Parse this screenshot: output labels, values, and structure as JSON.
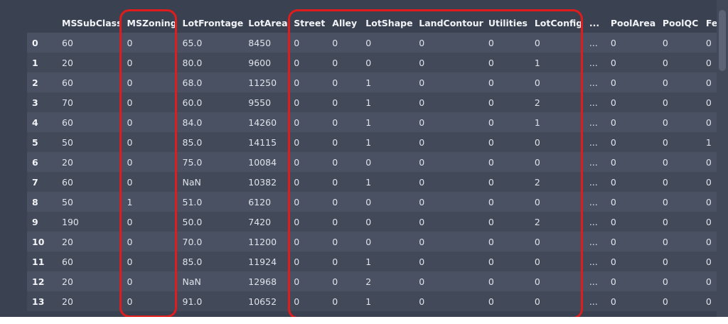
{
  "columns": [
    "",
    "MSSubClass",
    "MSZoning",
    "LotFrontage",
    "LotArea",
    "Street",
    "Alley",
    "LotShape",
    "LandContour",
    "Utilities",
    "LotConfig",
    "...",
    "PoolArea",
    "PoolQC",
    "Fe"
  ],
  "rows": [
    [
      "0",
      "60",
      "0",
      "65.0",
      "8450",
      "0",
      "0",
      "0",
      "0",
      "0",
      "0",
      "...",
      "0",
      "0",
      "0"
    ],
    [
      "1",
      "20",
      "0",
      "80.0",
      "9600",
      "0",
      "0",
      "0",
      "0",
      "0",
      "1",
      "...",
      "0",
      "0",
      "0"
    ],
    [
      "2",
      "60",
      "0",
      "68.0",
      "11250",
      "0",
      "0",
      "1",
      "0",
      "0",
      "0",
      "...",
      "0",
      "0",
      "0"
    ],
    [
      "3",
      "70",
      "0",
      "60.0",
      "9550",
      "0",
      "0",
      "1",
      "0",
      "0",
      "2",
      "...",
      "0",
      "0",
      "0"
    ],
    [
      "4",
      "60",
      "0",
      "84.0",
      "14260",
      "0",
      "0",
      "1",
      "0",
      "0",
      "1",
      "...",
      "0",
      "0",
      "0"
    ],
    [
      "5",
      "50",
      "0",
      "85.0",
      "14115",
      "0",
      "0",
      "1",
      "0",
      "0",
      "0",
      "...",
      "0",
      "0",
      "1"
    ],
    [
      "6",
      "20",
      "0",
      "75.0",
      "10084",
      "0",
      "0",
      "0",
      "0",
      "0",
      "0",
      "...",
      "0",
      "0",
      "0"
    ],
    [
      "7",
      "60",
      "0",
      "NaN",
      "10382",
      "0",
      "0",
      "1",
      "0",
      "0",
      "2",
      "...",
      "0",
      "0",
      "0"
    ],
    [
      "8",
      "50",
      "1",
      "51.0",
      "6120",
      "0",
      "0",
      "0",
      "0",
      "0",
      "0",
      "...",
      "0",
      "0",
      "0"
    ],
    [
      "9",
      "190",
      "0",
      "50.0",
      "7420",
      "0",
      "0",
      "0",
      "0",
      "0",
      "2",
      "...",
      "0",
      "0",
      "0"
    ],
    [
      "10",
      "20",
      "0",
      "70.0",
      "11200",
      "0",
      "0",
      "0",
      "0",
      "0",
      "0",
      "...",
      "0",
      "0",
      "0"
    ],
    [
      "11",
      "60",
      "0",
      "85.0",
      "11924",
      "0",
      "0",
      "1",
      "0",
      "0",
      "0",
      "...",
      "0",
      "0",
      "0"
    ],
    [
      "12",
      "20",
      "0",
      "NaN",
      "12968",
      "0",
      "0",
      "2",
      "0",
      "0",
      "0",
      "...",
      "0",
      "0",
      "0"
    ],
    [
      "13",
      "20",
      "0",
      "91.0",
      "10652",
      "0",
      "0",
      "1",
      "0",
      "0",
      "0",
      "...",
      "0",
      "0",
      "0"
    ]
  ],
  "colors": {
    "panel_bg": "#3a4150",
    "row_odd": "#4a5163",
    "row_even": "#424959",
    "highlight": "#e01c1c",
    "text": "#dfe3ea"
  }
}
